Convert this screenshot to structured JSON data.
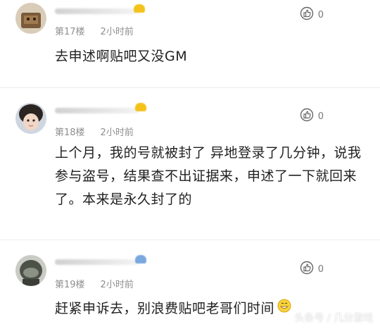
{
  "comments": [
    {
      "floor": "第17楼",
      "time": "2小时前",
      "likes": "0",
      "text": "去申述啊贴吧又没GM"
    },
    {
      "floor": "第18楼",
      "time": "2小时前",
      "likes": "0",
      "text": "上个月，我的号就被封了 异地登录了几分钟，说我参与盗号，结果查不出证据来，申述了一下就回来了。本来是永久封了的"
    },
    {
      "floor": "第19楼",
      "time": "2小时前",
      "likes": "0",
      "text": "赶紧申诉去，别浪费贴吧老哥们时间"
    }
  ],
  "watermark": "头条号 / 几分游戏",
  "icons": {
    "like": "thumbs-up-icon",
    "emoji": "grin-emoji-icon"
  },
  "colors": {
    "meta_text": "#8f8f8f",
    "body_text": "#1f1f1f",
    "divider": "#ececec"
  }
}
